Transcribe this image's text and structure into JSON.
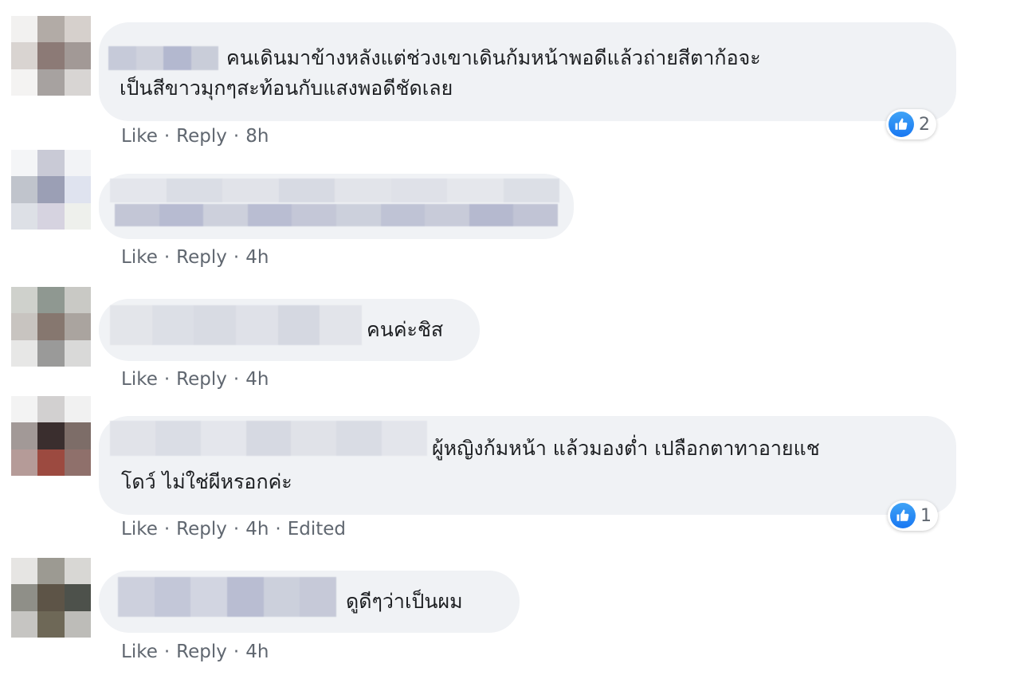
{
  "like_label": "Like",
  "reply_label": "Reply",
  "separator": "·",
  "comments": [
    {
      "text_line1": "คนเดินมาข้างหลังแต่ช่วงเขาเดินก้มหน้าพอดีแล้วถ่ายสีตาก้อจะ",
      "text_line2": "เป็นสีขาวมุกๆสะท้อนกับแสงพอดีชัดเลย",
      "time": "8h",
      "reactions": "2"
    },
    {
      "text_line1": "",
      "time": "4h"
    },
    {
      "text_line1": "คนค่ะชิส",
      "time": "4h"
    },
    {
      "text_line1": "ผู้หญิงก้มหน้า แล้วมองต่ำ เปลือกตาทาอายแช",
      "text_line2": "โดว์ ไม่ใช่ผีหรอกค่ะ",
      "time": "4h",
      "edited": "Edited",
      "reactions": "1"
    },
    {
      "text_line1": "ดูดีๆว่าเป็นผม",
      "time": "4h"
    }
  ]
}
